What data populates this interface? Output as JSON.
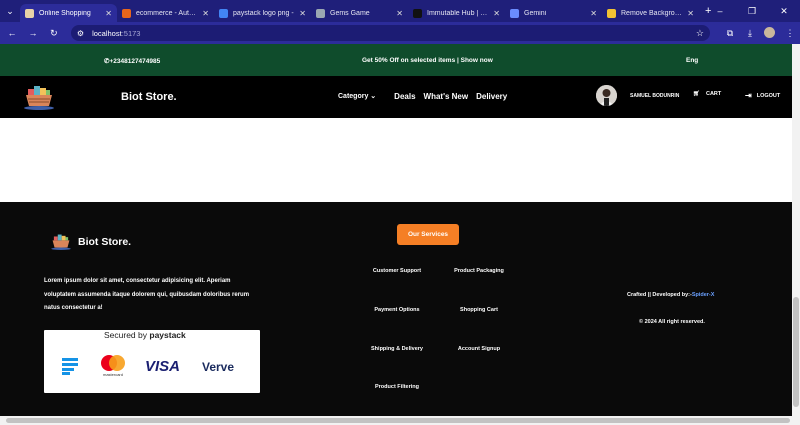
{
  "browser": {
    "tabs": [
      {
        "title": "Online Shopping",
        "favicon_color": "#e8d3a8",
        "active": true
      },
      {
        "title": "ecommerce - Authen",
        "favicon_color": "#e8661c",
        "active": false
      },
      {
        "title": "paystack logo png - ",
        "favicon_color": "#4285f4",
        "active": false
      },
      {
        "title": "Gems Game",
        "favicon_color": "#9aa7b2",
        "active": false
      },
      {
        "title": "Immutable Hub | We",
        "favicon_color": "#111111",
        "active": false
      },
      {
        "title": "Gemini",
        "favicon_color": "#6b8cff",
        "active": false
      },
      {
        "title": "Remove Background",
        "favicon_color": "#f2c233",
        "active": false
      }
    ],
    "url_host": "localhost",
    "url_port": ":5173"
  },
  "promo": {
    "phone": "+2348127474985",
    "offer": "Get 50% Off on selected items | Show now",
    "language": "Eng"
  },
  "nav": {
    "brand": "Biot Store.",
    "category": "Category",
    "links": [
      "Deals",
      "What's New",
      "Delivery"
    ],
    "user_name": "SAMUEL BODUNRIN",
    "cart": "CART",
    "logout": "LOGOUT"
  },
  "footer": {
    "brand": "Biot Store.",
    "description": "Lorem ipsum dolor sit amet, consectetur adipisicing elit. Aperiam voluptatem assumenda itaque dolorem qui, quibusdam doloribus rerum natus consectetur a!",
    "secured_by": "Secured by",
    "paystack": "paystack",
    "card_brands": [
      "mastercard",
      "VISA",
      "Verve"
    ],
    "services_button": "Our Services",
    "services": [
      "Customer Support",
      "Product Packaging",
      "Payment Options",
      "Shopping Cart",
      "Shipping & Delivery",
      "Account Signup",
      "Product Filtering"
    ],
    "credit_prefix": "Crafted || Developed by:-",
    "credit_dev": "Spider-X",
    "rights": "© 2024 All right reserved."
  },
  "colors": {
    "promo_bg": "#0f4c2c",
    "accent_orange": "#f57f25",
    "footer_bg": "#0a0a0a",
    "dev_link": "#6aa0ff"
  }
}
